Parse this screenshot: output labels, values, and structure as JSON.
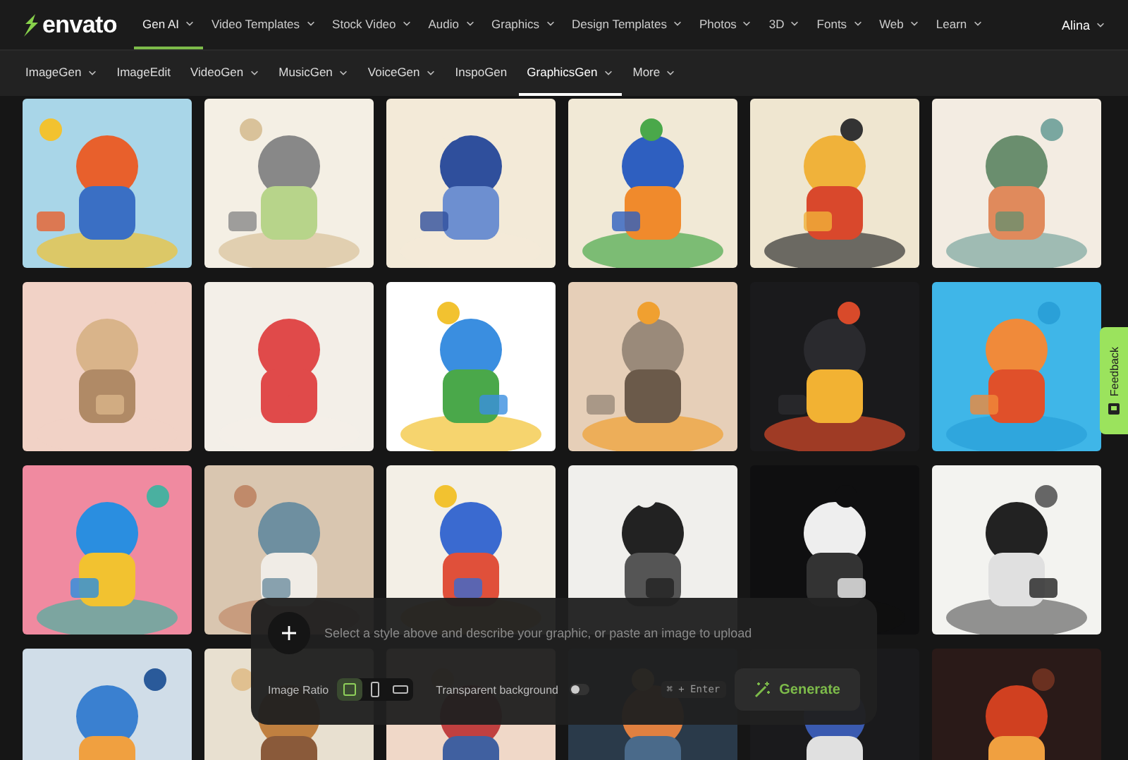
{
  "header": {
    "logo": "envato",
    "nav": [
      {
        "label": "Gen AI",
        "selected": true,
        "dropdown": true
      },
      {
        "label": "Video Templates",
        "selected": false,
        "dropdown": true
      },
      {
        "label": "Stock Video",
        "selected": false,
        "dropdown": true
      },
      {
        "label": "Audio",
        "selected": false,
        "dropdown": true
      },
      {
        "label": "Graphics",
        "selected": false,
        "dropdown": true
      },
      {
        "label": "Design Templates",
        "selected": false,
        "dropdown": true
      },
      {
        "label": "Photos",
        "selected": false,
        "dropdown": true
      },
      {
        "label": "3D",
        "selected": false,
        "dropdown": true
      },
      {
        "label": "Fonts",
        "selected": false,
        "dropdown": true
      },
      {
        "label": "Web",
        "selected": false,
        "dropdown": true
      },
      {
        "label": "Learn",
        "selected": false,
        "dropdown": true
      }
    ],
    "user": "Alina"
  },
  "subnav": [
    {
      "label": "ImageGen",
      "selected": false,
      "dropdown": true
    },
    {
      "label": "ImageEdit",
      "selected": false,
      "dropdown": false
    },
    {
      "label": "VideoGen",
      "selected": false,
      "dropdown": true
    },
    {
      "label": "MusicGen",
      "selected": false,
      "dropdown": true
    },
    {
      "label": "VoiceGen",
      "selected": false,
      "dropdown": true
    },
    {
      "label": "InspoGen",
      "selected": false,
      "dropdown": false
    },
    {
      "label": "GraphicsGen",
      "selected": true,
      "dropdown": true
    },
    {
      "label": "More",
      "selected": false,
      "dropdown": true
    }
  ],
  "prompt": {
    "placeholder": "Select a style above and describe your graphic, or paste an image to upload",
    "ratio_label": "Image Ratio",
    "ratios": [
      {
        "kind": "square",
        "selected": true
      },
      {
        "kind": "portrait",
        "selected": false
      },
      {
        "kind": "landscape",
        "selected": false
      }
    ],
    "transparent": {
      "label": "Transparent background",
      "on": false
    },
    "shortcut": "⌘ + Enter",
    "generate": "Generate"
  },
  "feedback": "Feedback"
}
